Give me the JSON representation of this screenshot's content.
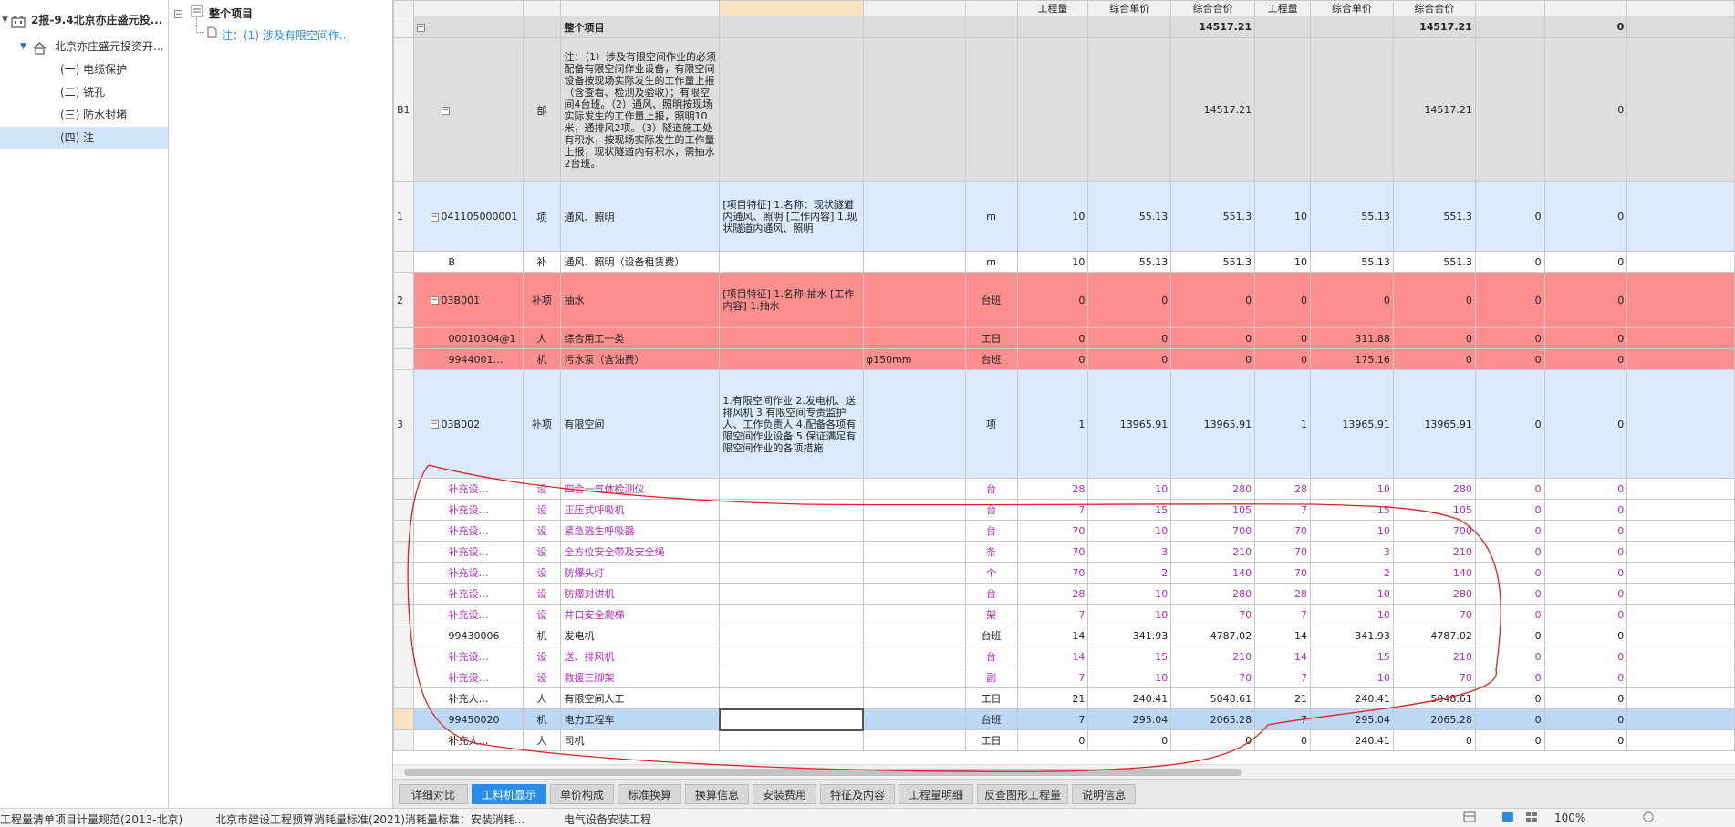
{
  "project_tree": {
    "root": "2报-9.4北京亦庄盛元投...",
    "unit": "北京亦庄盛元投资开...",
    "items": [
      "(一) 电缆保护",
      "(二) 铣孔",
      "(三) 防水封堵",
      "(四) 注"
    ]
  },
  "section_tree": {
    "root": "整个项目",
    "child": "注：(1) 涉及有限空间作..."
  },
  "table": {
    "headers": [
      "工程量",
      "综合单价",
      "综合合价",
      "工程量",
      "综合单价",
      "综合合价"
    ],
    "total": {
      "name": "整个项目",
      "amount1": "14517.21",
      "amount2": "14517.21",
      "last": "0"
    },
    "bu": {
      "idx": "B1",
      "type": "部",
      "name": "注：（1）涉及有限空间作业的必须配备有限空间作业设备，有限空间设备按现场实际发生的工作量上报（含查看、检测及验收）；有限空间4台班。（2）通风、照明按现场实际发生的工作量上报，照明10米，通排风2项。（3）隧道施工处有积水，按现场实际发生的工作量上报；现状隧道内有积水，需抽水2台班。",
      "amount1": "14517.21",
      "amount2": "14517.21",
      "last": "0"
    },
    "rows": [
      {
        "style": "qd",
        "idx": "1",
        "box": "−",
        "code": "041105000001",
        "type": "项",
        "name": "通风、照明",
        "feature": "[项目特征] 1.名称：现状隧道内通风、照明 [工作内容] 1.现状隧道内通风、照明",
        "spec": "",
        "unit": "m",
        "q1": "10",
        "p1": "55.13",
        "a1": "551.3",
        "q2": "10",
        "p2": "55.13",
        "a2": "551.3",
        "c1": "0",
        "c2": "0"
      },
      {
        "style": "white",
        "idx": "",
        "box": "",
        "code": "B",
        "type": "补",
        "name": "通风、照明（设备租赁费）",
        "feature": "",
        "spec": "",
        "unit": "m",
        "q1": "10",
        "p1": "55.13",
        "a1": "551.3",
        "q2": "10",
        "p2": "55.13",
        "a2": "551.3",
        "c1": "0",
        "c2": "0"
      },
      {
        "style": "red",
        "idx": "2",
        "box": "−",
        "code": "03B001",
        "type": "补项",
        "name": "抽水",
        "feature": "[项目特征] 1.名称:抽水 [工作内容] 1.抽水",
        "spec": "",
        "unit": "台班",
        "q1": "0",
        "p1": "0",
        "a1": "0",
        "q2": "0",
        "p2": "0",
        "a2": "0",
        "c1": "0",
        "c2": "0"
      },
      {
        "style": "red",
        "idx": "",
        "box": "",
        "code": "00010304@1",
        "type": "人",
        "name": "综合用工一类",
        "feature": "",
        "spec": "",
        "unit": "工日",
        "q1": "0",
        "p1": "0",
        "a1": "0",
        "q2": "0",
        "p2": "311.88",
        "a2": "0",
        "c1": "0",
        "c2": "0"
      },
      {
        "style": "red",
        "idx": "",
        "box": "",
        "code": "9944001…",
        "type": "机",
        "name": "污水泵（含油费）",
        "feature": "",
        "spec": "φ150mm",
        "unit": "台班",
        "q1": "0",
        "p1": "0",
        "a1": "0",
        "q2": "0",
        "p2": "175.16",
        "a2": "0",
        "c1": "0",
        "c2": "0"
      },
      {
        "style": "qd",
        "idx": "3",
        "box": "−",
        "code": "03B002",
        "type": "补项",
        "name": "有限空间",
        "feature": "1.有限空间作业 2.发电机、送排风机 3.有限空间专责监护人、工作负责人 4.配备各项有限空间作业设备 5.保证满足有限空间作业的各项措施",
        "spec": "",
        "unit": "项",
        "q1": "1",
        "p1": "13965.91",
        "a1": "13965.91",
        "q2": "1",
        "p2": "13965.91",
        "a2": "13965.91",
        "c1": "0",
        "c2": "0"
      },
      {
        "style": "purple",
        "idx": "",
        "box": "",
        "code": "补充设…",
        "type": "设",
        "name": "四合一气体检测仪",
        "feature": "",
        "spec": "",
        "unit": "台",
        "q1": "28",
        "p1": "10",
        "a1": "280",
        "q2": "28",
        "p2": "10",
        "a2": "280",
        "c1": "0",
        "c2": "0"
      },
      {
        "style": "purple",
        "idx": "",
        "box": "",
        "code": "补充设…",
        "type": "设",
        "name": "正压式呼吸机",
        "feature": "",
        "spec": "",
        "unit": "台",
        "q1": "7",
        "p1": "15",
        "a1": "105",
        "q2": "7",
        "p2": "15",
        "a2": "105",
        "c1": "0",
        "c2": "0"
      },
      {
        "style": "purple",
        "idx": "",
        "box": "",
        "code": "补充设…",
        "type": "设",
        "name": "紧急逃生呼吸器",
        "feature": "",
        "spec": "",
        "unit": "台",
        "q1": "70",
        "p1": "10",
        "a1": "700",
        "q2": "70",
        "p2": "10",
        "a2": "700",
        "c1": "0",
        "c2": "0"
      },
      {
        "style": "purple",
        "idx": "",
        "box": "",
        "code": "补充设…",
        "type": "设",
        "name": "全方位安全带及安全绳",
        "feature": "",
        "spec": "",
        "unit": "条",
        "q1": "70",
        "p1": "3",
        "a1": "210",
        "q2": "70",
        "p2": "3",
        "a2": "210",
        "c1": "0",
        "c2": "0"
      },
      {
        "style": "purple",
        "idx": "",
        "box": "",
        "code": "补充设…",
        "type": "设",
        "name": "防爆头灯",
        "feature": "",
        "spec": "",
        "unit": "个",
        "q1": "70",
        "p1": "2",
        "a1": "140",
        "q2": "70",
        "p2": "2",
        "a2": "140",
        "c1": "0",
        "c2": "0"
      },
      {
        "style": "purple",
        "idx": "",
        "box": "",
        "code": "补充设…",
        "type": "设",
        "name": "防爆对讲机",
        "feature": "",
        "spec": "",
        "unit": "台",
        "q1": "28",
        "p1": "10",
        "a1": "280",
        "q2": "28",
        "p2": "10",
        "a2": "280",
        "c1": "0",
        "c2": "0"
      },
      {
        "style": "purple",
        "idx": "",
        "box": "",
        "code": "补充设…",
        "type": "设",
        "name": "井口安全爬梯",
        "feature": "",
        "spec": "",
        "unit": "架",
        "q1": "7",
        "p1": "10",
        "a1": "70",
        "q2": "7",
        "p2": "10",
        "a2": "70",
        "c1": "0",
        "c2": "0"
      },
      {
        "style": "white",
        "idx": "",
        "box": "",
        "code": "99430006",
        "type": "机",
        "name": "发电机",
        "feature": "",
        "spec": "",
        "unit": "台班",
        "q1": "14",
        "p1": "341.93",
        "a1": "4787.02",
        "q2": "14",
        "p2": "341.93",
        "a2": "4787.02",
        "c1": "0",
        "c2": "0"
      },
      {
        "style": "purple",
        "idx": "",
        "box": "",
        "code": "补充设…",
        "type": "设",
        "name": "送、排风机",
        "feature": "",
        "spec": "",
        "unit": "台",
        "q1": "14",
        "p1": "15",
        "a1": "210",
        "q2": "14",
        "p2": "15",
        "a2": "210",
        "c1": "0",
        "c2": "0"
      },
      {
        "style": "purple",
        "idx": "",
        "box": "",
        "code": "补充设…",
        "type": "设",
        "name": "救援三脚架",
        "feature": "",
        "spec": "",
        "unit": "副",
        "q1": "7",
        "p1": "10",
        "a1": "70",
        "q2": "7",
        "p2": "10",
        "a2": "70",
        "c1": "0",
        "c2": "0"
      },
      {
        "style": "white",
        "idx": "",
        "box": "",
        "code": "补充人…",
        "type": "人",
        "name": "有限空间人工",
        "feature": "",
        "spec": "",
        "unit": "工日",
        "q1": "21",
        "p1": "240.41",
        "a1": "5048.61",
        "q2": "21",
        "p2": "240.41",
        "a2": "5048.61",
        "c1": "0",
        "c2": "0"
      },
      {
        "style": "sel",
        "idx": "",
        "box": "",
        "code": "99450020",
        "type": "机",
        "name": "电力工程车",
        "feature": "",
        "spec": "",
        "unit": "台班",
        "q1": "7",
        "p1": "295.04",
        "a1": "2065.28",
        "q2": "7",
        "p2": "295.04",
        "a2": "2065.28",
        "c1": "0",
        "c2": "0"
      },
      {
        "style": "white",
        "idx": "",
        "box": "",
        "code": "补充人…",
        "type": "人",
        "name": "司机",
        "feature": "",
        "spec": "",
        "unit": "工日",
        "q1": "0",
        "p1": "0",
        "a1": "0",
        "q2": "0",
        "p2": "240.41",
        "a2": "0",
        "c1": "0",
        "c2": "0"
      }
    ]
  },
  "tabs": [
    "详细对比",
    "工料机显示",
    "单价构成",
    "标准换算",
    "换算信息",
    "安装费用",
    "特征及内容",
    "工程量明细",
    "反查图形工程量",
    "说明信息"
  ],
  "active_tab": "工料机显示",
  "status_bar": {
    "item1": "工程量清单项目计量规范(2013-北京)",
    "item2": "北京市建设工程预算消耗量标准(2021)消耗量标准：安装消耗...",
    "item3": "电气设备安装工程",
    "zoom": "100%"
  },
  "colors": {
    "accent": "#2a8ee8",
    "red_row": "#fb8f8f",
    "qd_row": "#dbe9fb",
    "purple_text": "#b32bbf",
    "annotation": "#e02020"
  }
}
